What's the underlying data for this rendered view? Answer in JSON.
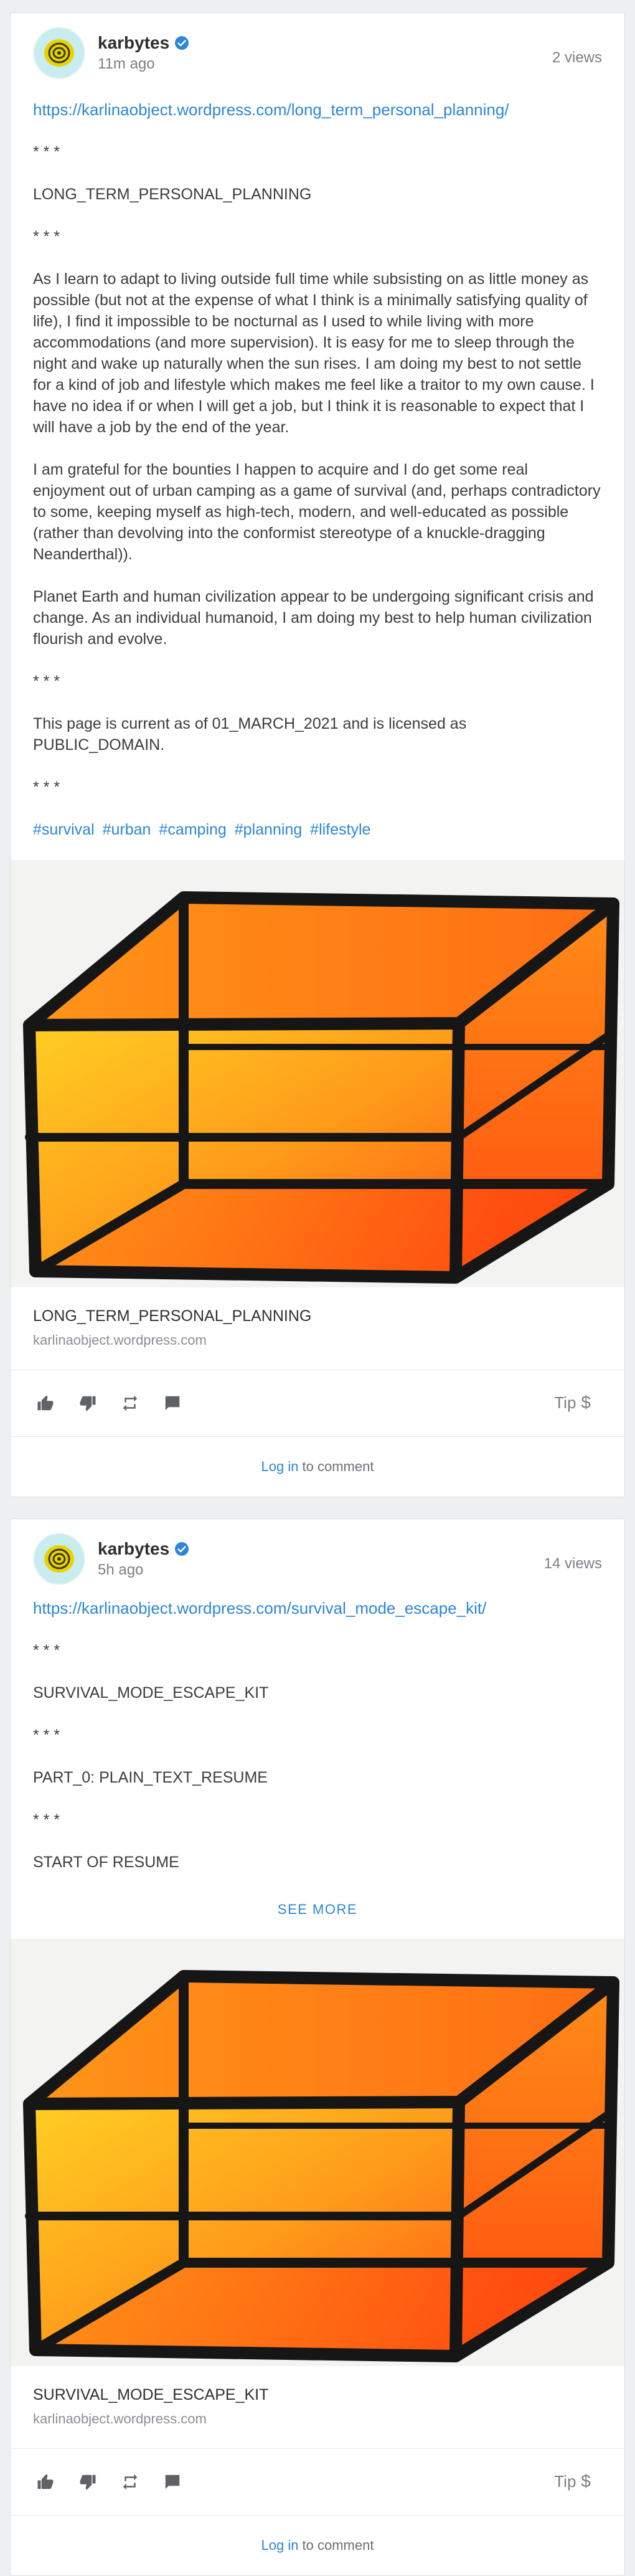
{
  "posts": [
    {
      "author": "karbytes",
      "time": "11m ago",
      "views": "2 views",
      "link": "https://karlinaobject.wordpress.com/long_term_personal_planning/",
      "paragraphs": [
        "* * *",
        "LONG_TERM_PERSONAL_PLANNING",
        "* * *",
        "As I learn to adapt to living outside full time while subsisting on as little money as possible (but not at the expense of what I think is a minimally satisfying quality of life), I find it impossible to be nocturnal as I used to while living with more accommodations (and more supervision). It is easy for me to sleep through the night and wake up naturally when the sun rises. I am doing my best to not settle for a kind of job and lifestyle which makes me feel like a traitor to my own cause. I have no idea if or when I will get a job, but I think it is reasonable to expect that I will have a job by the end of the year.",
        "I am grateful for the bounties I happen to acquire and I do get some real enjoyment out of urban camping as a game of survival (and, perhaps contradictory to some, keeping myself as high-tech, modern, and well-educated as possible (rather than devolving into the conformist stereotype of a knuckle-dragging Neanderthal)).",
        "Planet Earth and human civilization appear to be undergoing significant crisis and change. As an individual humanoid, I am doing my best to help human civilization flourish and evolve.",
        "* * *",
        "This page is current as of 01_MARCH_2021 and is licensed as PUBLIC_DOMAIN.",
        "* * *"
      ],
      "hashtags": [
        "#survival",
        "#urban",
        "#camping",
        "#planning",
        "#lifestyle"
      ],
      "preview_title": "LONG_TERM_PERSONAL_PLANNING",
      "preview_domain": "karlinaobject.wordpress.com",
      "tip_label": "Tip",
      "login_label": "Log in",
      "comment_suffix": "to comment"
    },
    {
      "author": "karbytes",
      "time": "5h ago",
      "views": "14 views",
      "link": "https://karlinaobject.wordpress.com/survival_mode_escape_kit/",
      "paragraphs": [
        "* * *",
        "SURVIVAL_MODE_ESCAPE_KIT",
        "* * *",
        "PART_0: PLAIN_TEXT_RESUME",
        "* * *",
        "START OF RESUME"
      ],
      "see_more": "SEE MORE",
      "preview_title": "SURVIVAL_MODE_ESCAPE_KIT",
      "preview_domain": "karlinaobject.wordpress.com",
      "tip_label": "Tip",
      "login_label": "Log in",
      "comment_suffix": "to comment"
    }
  ],
  "icons": {
    "verified": "verified-badge-icon",
    "like": "thumbs-up-icon",
    "dislike": "thumbs-down-icon",
    "repost": "repost-icon",
    "comment": "comment-icon",
    "tip": "dollar-icon"
  },
  "colors": {
    "link": "#2d86d6",
    "verified": "#2d86d6",
    "cube_orange": "#ff7a12",
    "cube_edges": "#161616"
  }
}
